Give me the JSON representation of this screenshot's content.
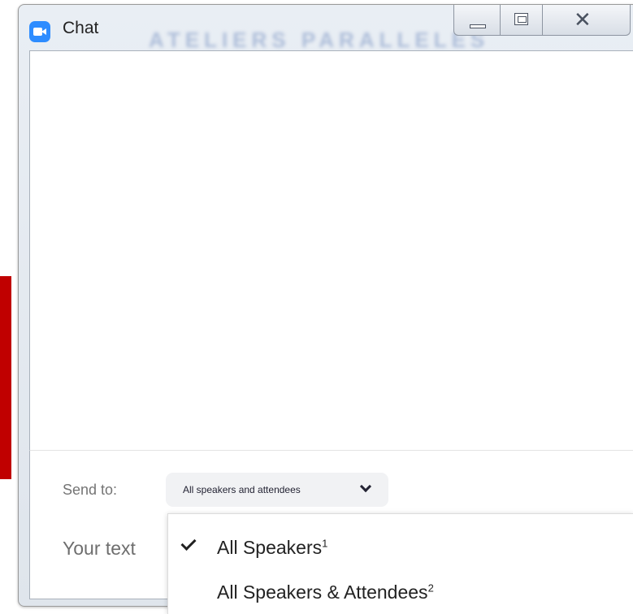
{
  "window": {
    "title": "Chat",
    "background_text": "ATELIERS PARALLELES"
  },
  "bottom": {
    "send_to_label": "Send to:",
    "send_to_value": "All speakers and attendees",
    "your_text_label": "Your text"
  },
  "menu": {
    "items": [
      {
        "label": "All Speakers",
        "sup": "1",
        "checked": true
      },
      {
        "label": "All Speakers & Attendees",
        "sup": "2",
        "checked": false
      }
    ]
  },
  "colors": {
    "accent": "#2d8cff",
    "slide_red": "#c00000"
  }
}
